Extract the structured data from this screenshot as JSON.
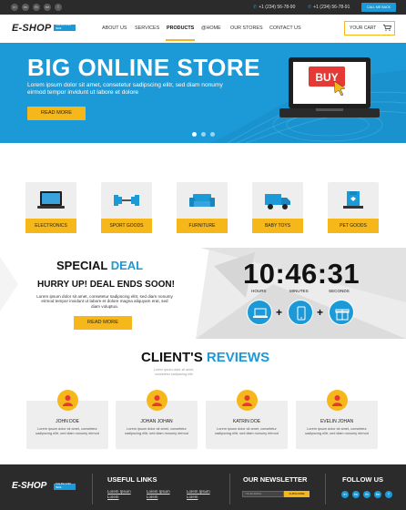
{
  "topbar": {
    "social": [
      "in",
      "tw",
      "fb",
      "be",
      "T"
    ],
    "phones": [
      "+1 (234) 56-78-90",
      "+1 (234) 56-78-91"
    ],
    "call_button": "CALL ME BACK"
  },
  "header": {
    "logo": "E-SHOP",
    "logo_tagline": "TAGLINE GOES HERE",
    "nav": [
      "ABOUT US",
      "SERVICES",
      "PRODUCTS",
      "@HOME",
      "OUR STORES",
      "CONTACT US"
    ],
    "active_nav": "PRODUCTS",
    "cart_label": "YOUR CART"
  },
  "hero": {
    "title": "BIG ONLINE STORE",
    "text": "Lorem ipsum dolor sit amet, consetetur sadipscing elitr, sed diam nonumy eirmod tempor invidunt ut labore et dolore",
    "button": "READ MORE",
    "screen_badge": "BUY",
    "slides": 3,
    "active_slide": 1
  },
  "categories": [
    {
      "label": "ELECTRONICS",
      "icon": "laptop-icon"
    },
    {
      "label": "SPORT GOODS",
      "icon": "dumbbell-icon"
    },
    {
      "label": "FURNITURE",
      "icon": "sofa-icon"
    },
    {
      "label": "BABY TOYS",
      "icon": "truck-icon"
    },
    {
      "label": "PET GOODS",
      "icon": "pet-bowl-icon"
    }
  ],
  "deal": {
    "title_plain": "SPECIAL",
    "title_highlight": "DEAL",
    "subtitle": "HURRY UP! DEAL ENDS SOON!",
    "text": "Lorem ipsum dolor sit amet, consetetur sadipscing elitr, sed diam nonumy eirmod tempor invidunt ut labore et dolore magna aliquyam erat, sed diam voluptua.",
    "button": "READ MORE",
    "timer": "10:46:31",
    "timer_labels": [
      "HOURS",
      "MINUTES",
      "SECONDS"
    ],
    "bundle_icons": [
      "laptop-icon",
      "phone-icon",
      "gift-icon"
    ]
  },
  "reviews": {
    "title_plain": "CLIENT'S",
    "title_highlight": "REVIEWS",
    "subtitle": "Lorem ipsum dolor sit amet, consetetur sadipscing elitr",
    "items": [
      {
        "name": "JOHN DOE",
        "text": "Lorem ipsum dolor sit amet, consetetur sadipscing elitr, sed diam nonumy eirmod"
      },
      {
        "name": "JOHAN JOHAN",
        "text": "Lorem ipsum dolor sit amet, consetetur sadipscing elitr, sed diam nonumy eirmod"
      },
      {
        "name": "KATRIN DOE",
        "text": "Lorem ipsum dolor sit amet, consetetur sadipscing elitr, sed diam nonumy eirmod"
      },
      {
        "name": "EVELIN JOHAN",
        "text": "Lorem ipsum dolor sit amet, consetetur sadipscing elitr, sed diam nonumy eirmod"
      }
    ]
  },
  "footer": {
    "logo": "E-SHOP",
    "logo_tagline": "TAGLINE GOES HERE",
    "links_title": "USEFUL LINKS",
    "links": [
      "Lorem Ipsum",
      "Lorem Ipsum",
      "Lorem Ipsum",
      "Lorem",
      "Lorem",
      "Lorem"
    ],
    "newsletter_title": "OUR NEWSLETTER",
    "email_placeholder": "YOUR EMAIL",
    "subscribe": "SUBSCRIBE",
    "follow_title": "FOLLOW US",
    "social": [
      "in",
      "tw",
      "fb",
      "be",
      "T"
    ]
  },
  "colors": {
    "accent": "#1c9ad8",
    "yellow": "#f6b71b",
    "dark": "#2b2b2b",
    "light_gray": "#eeeeee"
  }
}
